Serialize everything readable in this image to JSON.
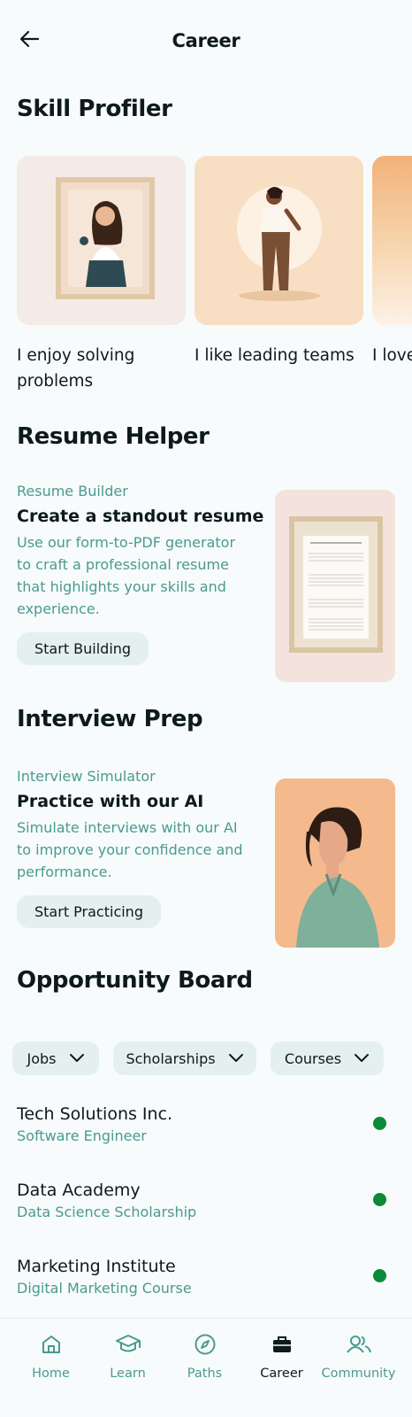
{
  "header": {
    "title": "Career"
  },
  "skill_profiler": {
    "title": "Skill Profiler",
    "cards": [
      {
        "caption": "I enjoy solving problems"
      },
      {
        "caption": "I like leading teams"
      },
      {
        "caption": "I love ideas"
      }
    ]
  },
  "resume_helper": {
    "title": "Resume Helper",
    "kicker": "Resume Builder",
    "heading": "Create a standout resume",
    "description": "Use our form-to-PDF generator to craft a professional resume that highlights your skills and experience.",
    "button_label": "Start Building"
  },
  "interview_prep": {
    "title": "Interview Prep",
    "kicker": "Interview Simulator",
    "heading": "Practice with our AI",
    "description": "Simulate interviews with our AI to improve your confidence and performance.",
    "button_label": "Start Practicing"
  },
  "opportunity_board": {
    "title": "Opportunity Board",
    "filters": [
      {
        "label": "Jobs"
      },
      {
        "label": "Scholarships"
      },
      {
        "label": "Courses"
      }
    ],
    "items": [
      {
        "name": "Tech Solutions Inc.",
        "subtitle": "Software Engineer",
        "status_color": "#0a8a3a"
      },
      {
        "name": "Data Academy",
        "subtitle": "Data Science Scholarship",
        "status_color": "#0a8a3a"
      },
      {
        "name": "Marketing Institute",
        "subtitle": "Digital Marketing Course",
        "status_color": "#0a8a3a"
      }
    ]
  },
  "bottom_nav": {
    "items": [
      {
        "label": "Home",
        "icon": "home-icon"
      },
      {
        "label": "Learn",
        "icon": "graduation-cap-icon"
      },
      {
        "label": "Paths",
        "icon": "compass-icon"
      },
      {
        "label": "Career",
        "icon": "briefcase-icon",
        "active": true
      },
      {
        "label": "Community",
        "icon": "people-icon"
      }
    ]
  },
  "colors": {
    "accent": "#4a9a90",
    "background": "#f7fbfb",
    "pill": "#e4f0ef",
    "status": "#0a8a3a"
  }
}
